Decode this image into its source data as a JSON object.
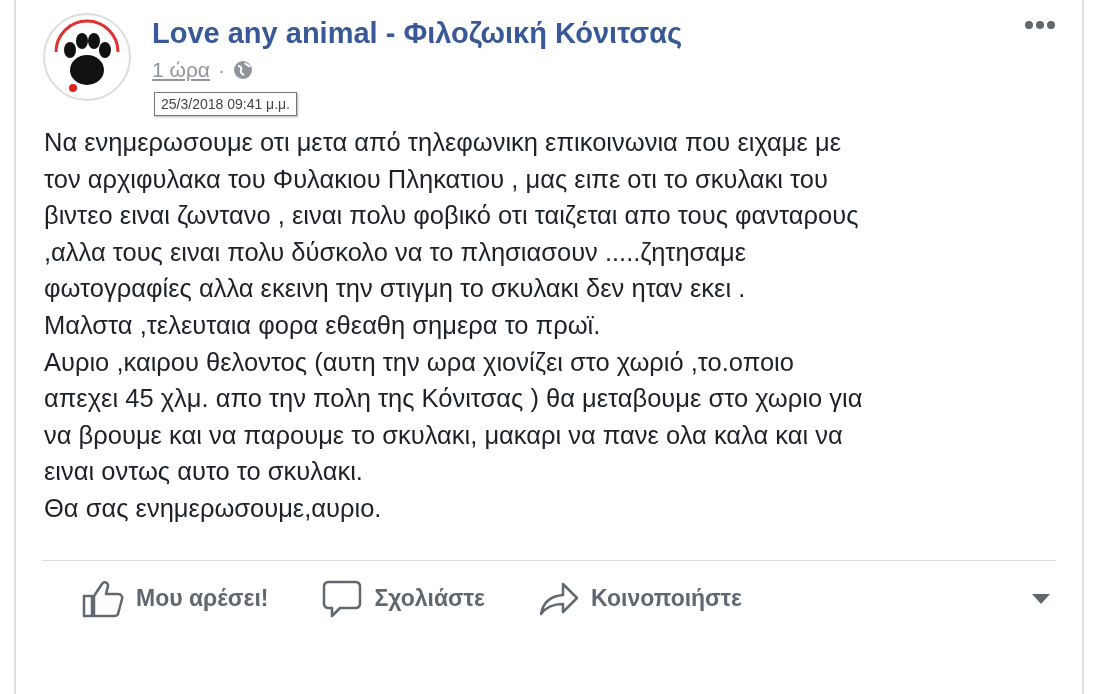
{
  "post": {
    "author": "Love any animal - Φιλοζωική Κόνιτσας",
    "time": "1 ώρα",
    "separator": "·",
    "tooltip": "25/3/2018 09:41 μ.μ.",
    "lines": [
      "Να ενημερωσουμε οτι μετα από τηλεφωνικη επικοινωνια που ειχαμε με",
      "τον αρχιφυλακα του Φυλακιου Πληκατιου , μας ειπε οτι το σκυλακι του",
      "βιντεο ειναι ζωντανο , ειναι πολυ φοβικό οτι ταιζεται απο τους φανταρους",
      ",αλλα τους ειναι πολυ δύσκολο να το πλησιασουν .....ζητησαμε",
      "φωτογραφίες αλλα εκεινη την στιγμη το σκυλακι δεν ηταν εκει .",
      "Μαλστα ,τελευταια φορα εθεαθη σημερα το πρωϊ.",
      "Αυριο ,καιρου θελοντος (αυτη την ωρα χιονίζει στο χωριό ,το.οποιο",
      "απεχει 45 χλμ. απο την πολη της Κόνιτσας ) θα μεταβουμε στο χωριο για",
      "να βρουμε και να παρουμε το σκυλακι, μακαρι να πανε ολα καλα και να",
      "ειναι οντως αυτο το σκυλακι.",
      "Θα σας ενημερωσουμε,αυριο."
    ]
  },
  "actions": [
    {
      "kind": "like",
      "label": "Μου αρέσει!"
    },
    {
      "kind": "comment",
      "label": "Σχολιάστε"
    },
    {
      "kind": "share",
      "label": "Κοινοποιήστε"
    }
  ]
}
